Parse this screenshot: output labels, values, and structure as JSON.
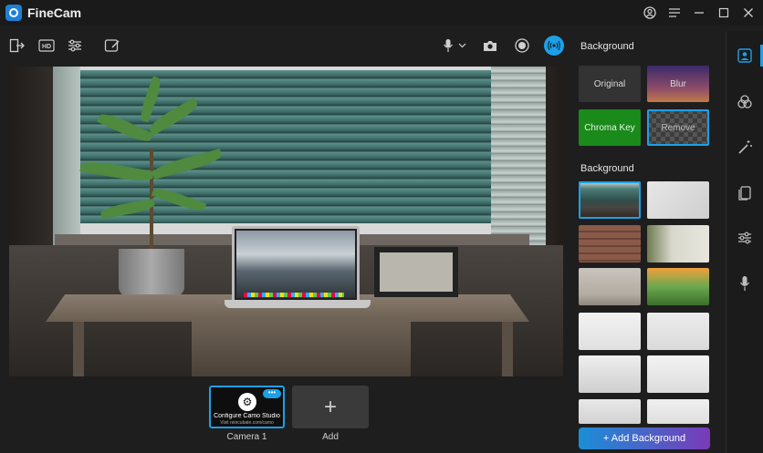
{
  "app": {
    "title": "FineCam"
  },
  "window_controls": [
    "account-icon",
    "menu-icon",
    "minimize-icon",
    "maximize-icon",
    "close-icon"
  ],
  "toolbar": {
    "left_tools": [
      "exit-icon",
      "hd-icon",
      "adjust-sliders-icon",
      "annotate-icon"
    ],
    "right_tools": [
      "microphone-icon",
      "chevron-down-icon",
      "snapshot-camera-icon",
      "record-icon",
      "live-broadcast-icon"
    ],
    "hd_label": "HD"
  },
  "camera_strip": {
    "cameras": [
      {
        "label": "Camera 1",
        "thumb_title": "Configure Camo Studio",
        "thumb_sub": "Visit reincubate.com/camo"
      }
    ],
    "add_label": "Add"
  },
  "panel": {
    "mode_title": "Background",
    "modes": [
      {
        "label": "Original",
        "bg": "#333333"
      },
      {
        "label": "Blur",
        "bg": "linear"
      },
      {
        "label": "Chroma Key",
        "bg": "#1a8a1a"
      },
      {
        "label": "Remove",
        "bg": "checker"
      }
    ],
    "gallery_title": "Background",
    "add_button": "+ Add Background"
  },
  "rail": {
    "items": [
      "portrait-icon",
      "effects-icon",
      "magic-wand-icon",
      "layers-icon",
      "sliders-icon",
      "microphone-icon"
    ]
  },
  "colors": {
    "accent": "#1ca0e8",
    "chroma": "#1a8a1a",
    "gradient_end": "#7a3ab8"
  }
}
